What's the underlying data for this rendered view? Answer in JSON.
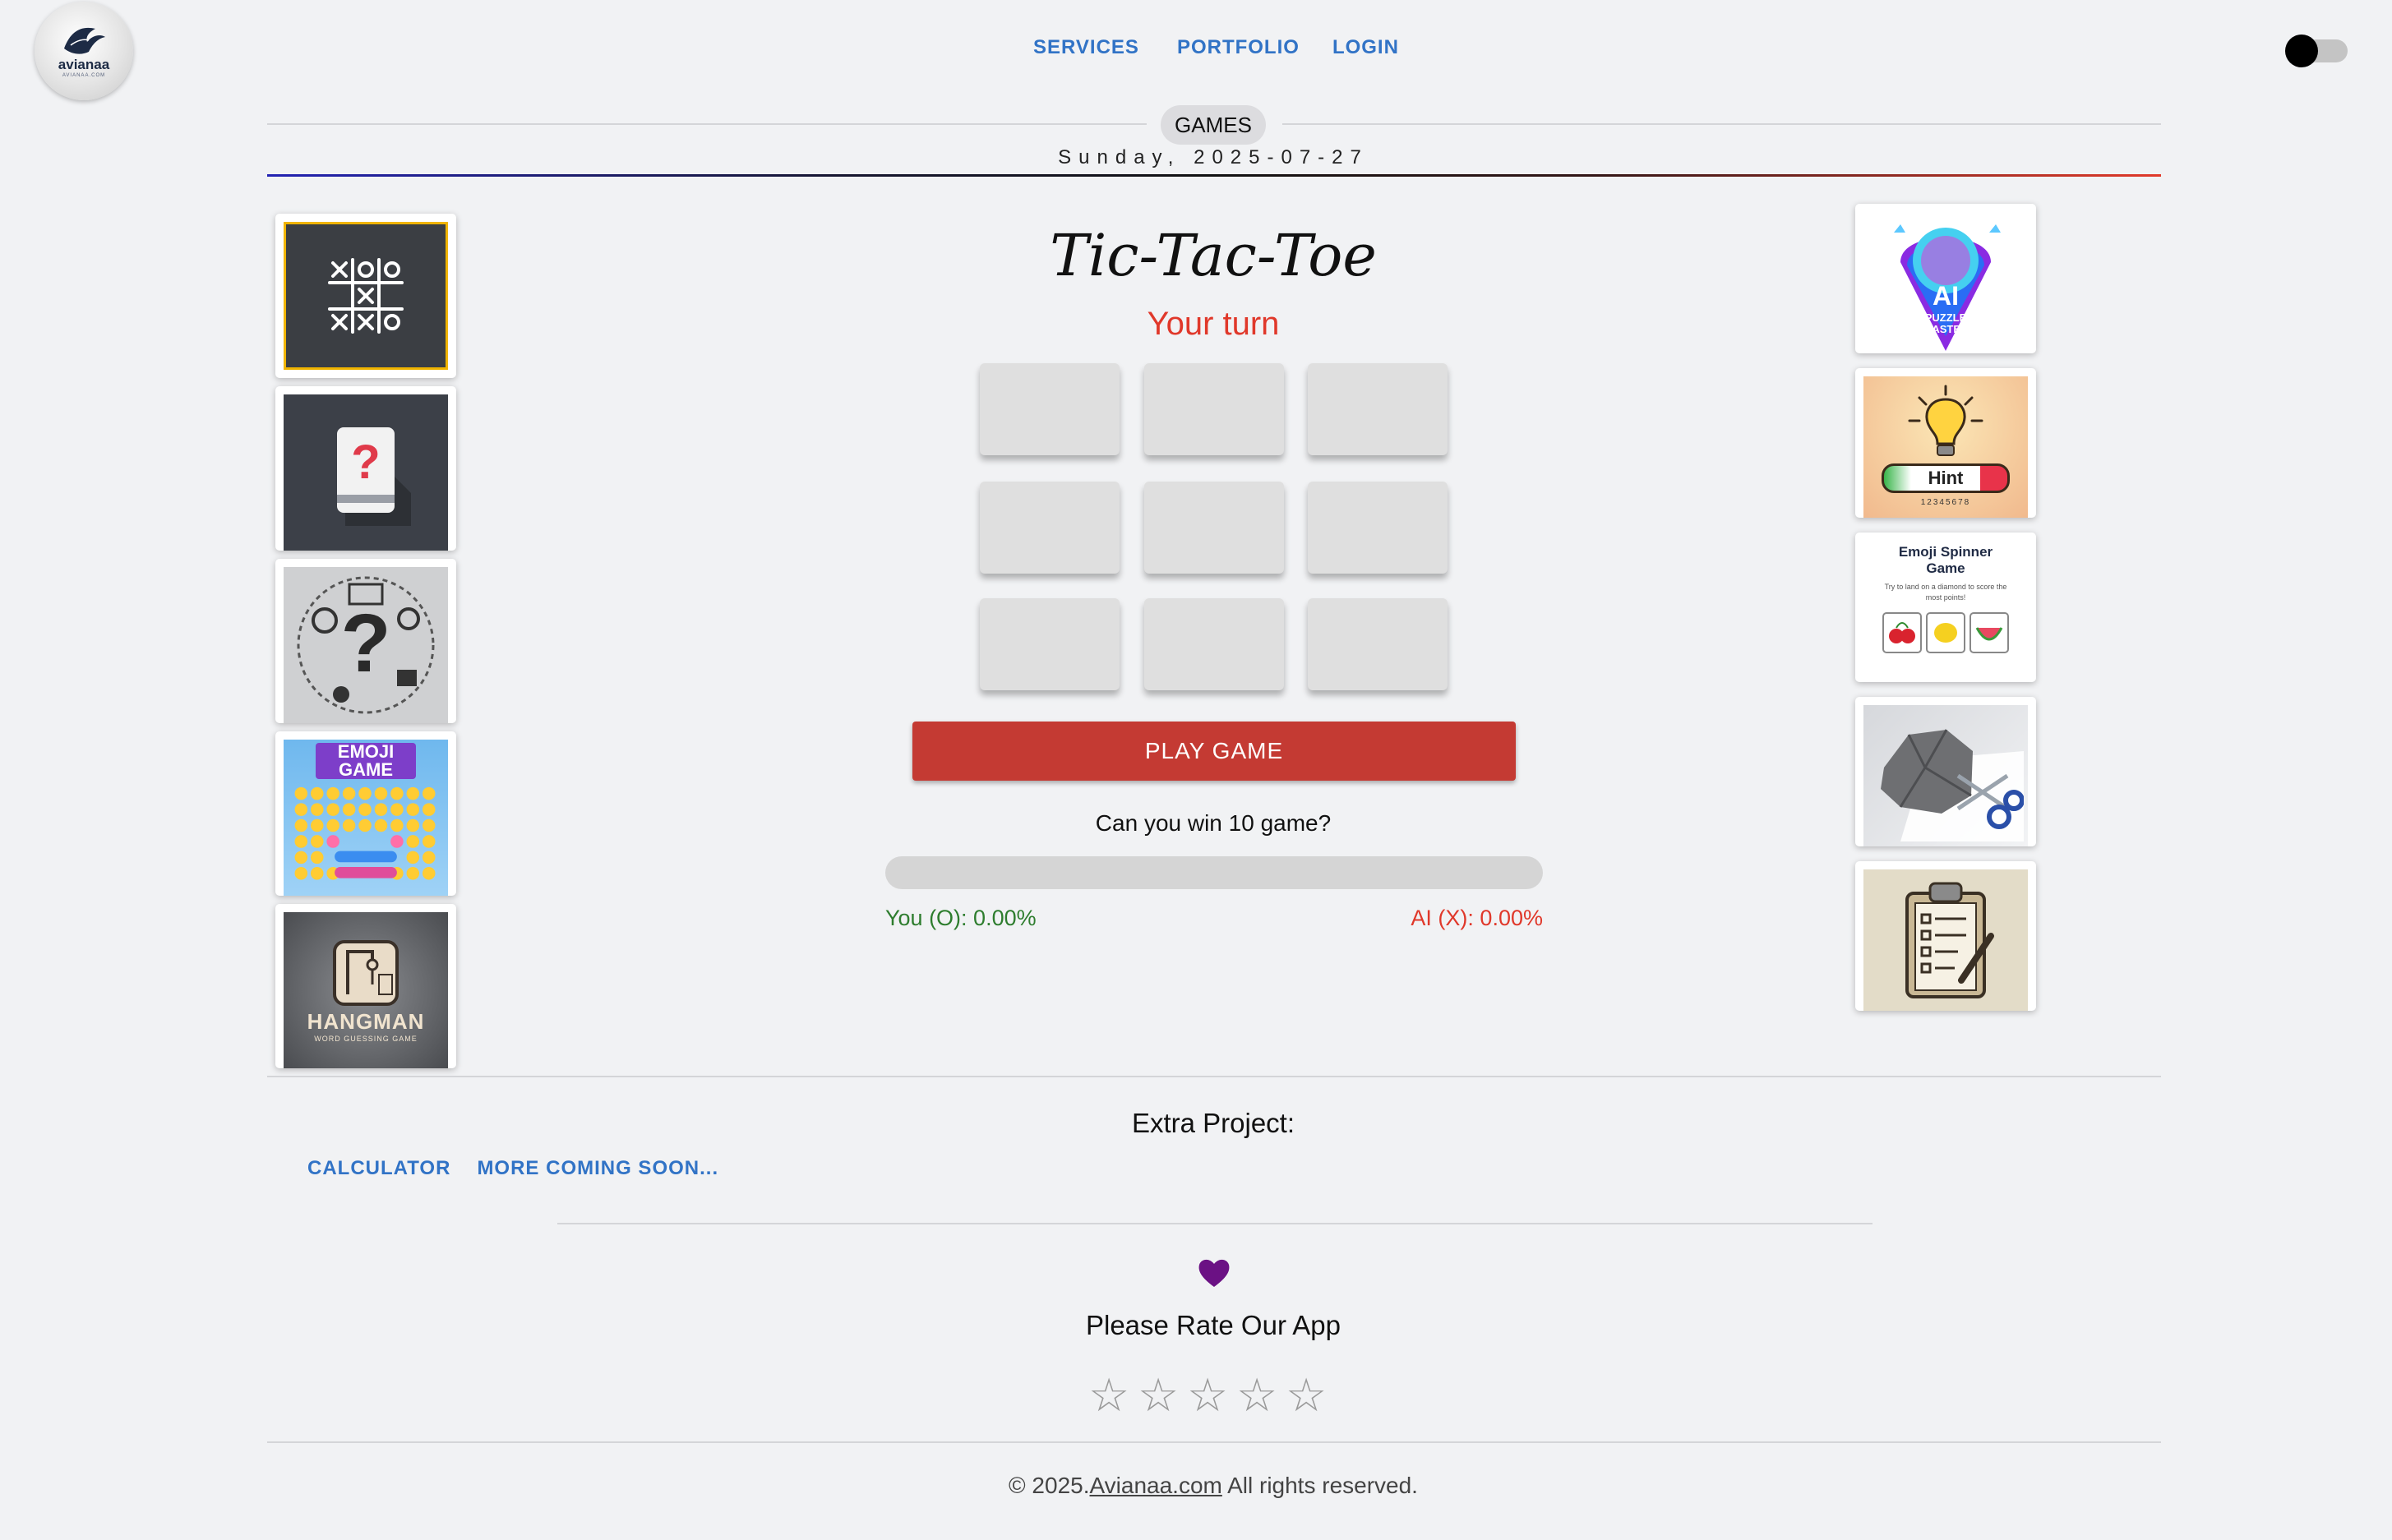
{
  "header": {
    "logo_text": "avianaa",
    "logo_sub": "AVIANAA.COM",
    "nav": [
      "SERVICES",
      "PORTFOLIO",
      "LOGIN"
    ]
  },
  "section": {
    "label": "GAMES",
    "date": "Sunday, 2025-07-27"
  },
  "left_games": [
    {
      "icon": "tic-tac-toe-thumbnail"
    },
    {
      "icon": "quiz-card-thumbnail"
    },
    {
      "icon": "trivia-question-thumbnail"
    },
    {
      "icon": "emoji-game-thumbnail",
      "title": "EMOJI GAME"
    },
    {
      "icon": "hangman-thumbnail",
      "title": "HANGMAN",
      "subtitle": "WORD GUESSING GAME"
    }
  ],
  "right_games": [
    {
      "icon": "ai-puzzle-master-thumbnail",
      "title": "AI",
      "subtitle": "PUZZLE MASTER"
    },
    {
      "icon": "hint-lightbulb-thumbnail",
      "title": "Hint",
      "subtitle": "12345678"
    },
    {
      "icon": "emoji-spinner-thumbnail",
      "title": "Emoji Spinner Game",
      "subtitle": "Try to land on a diamond to score the most points!"
    },
    {
      "icon": "rock-paper-scissors-thumbnail"
    },
    {
      "icon": "checklist-clipboard-thumbnail"
    }
  ],
  "game": {
    "title": "Tic-Tac-Toe",
    "status": "Your turn",
    "board": [
      "",
      "",
      "",
      "",
      "",
      "",
      "",
      "",
      ""
    ],
    "play_button": "PLAY GAME",
    "question": "Can you win 10 game?",
    "progress": 0,
    "you_score": "You (O): 0.00%",
    "ai_score": "AI (X): 0.00%"
  },
  "extra": {
    "title": "Extra Project:",
    "links": [
      "CALCULATOR",
      "MORE COMING SOON..."
    ]
  },
  "rating": {
    "prompt": "Please Rate Our App",
    "stars": 5,
    "value": 0,
    "heart_color": "#6b1184"
  },
  "footer": {
    "prefix": "© 2025.",
    "link": "Avianaa.com",
    "suffix": " All rights reserved."
  },
  "colors": {
    "accent_link": "#3173c6",
    "play_button": "#c43a33",
    "turn_text": "#e0382a",
    "you_text": "#2e7d2e"
  }
}
